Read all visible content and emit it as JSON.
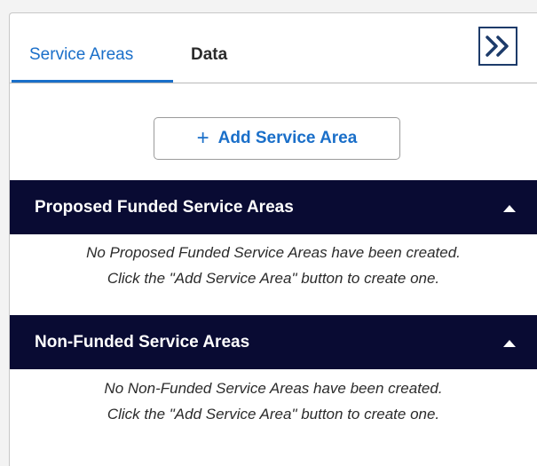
{
  "tabs": [
    {
      "label": "Service Areas",
      "active": true
    },
    {
      "label": "Data",
      "active": false
    }
  ],
  "collapse_button": {
    "icon": "double-chevron-right-icon",
    "color": "#1d3b6a"
  },
  "add_button": {
    "label": "Add Service Area",
    "icon": "plus-icon",
    "icon_glyph": "+"
  },
  "sections": [
    {
      "title": "Proposed Funded Service Areas",
      "expanded": true,
      "message_line1": "No Proposed Funded Service Areas have been created.",
      "message_line2": "Click the \"Add Service Area\" button to create one."
    },
    {
      "title": "Non-Funded Service Areas",
      "expanded": true,
      "message_line1": "No Non-Funded Service Areas have been created.",
      "message_line2": "Click the \"Add Service Area\" button to create one."
    }
  ],
  "colors": {
    "accent": "#1a6fc9",
    "section_header_bg": "#090b33",
    "section_header_text": "#ffffff"
  }
}
